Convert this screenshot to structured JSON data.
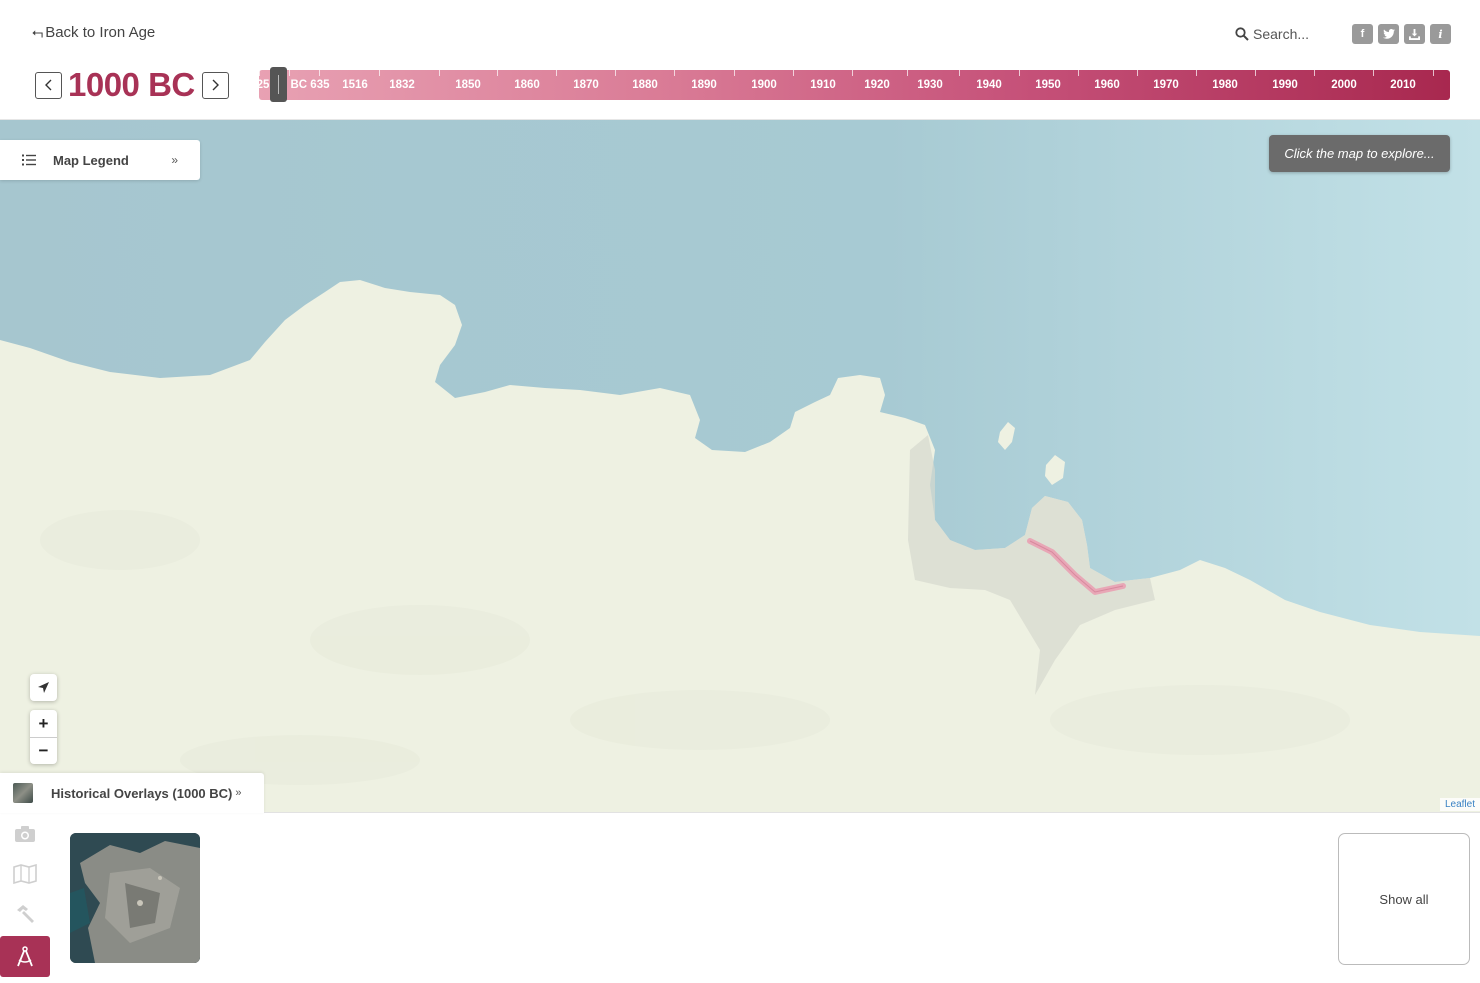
{
  "header": {
    "back_label": "Back to Iron Age",
    "search_label": "Search...",
    "social": [
      {
        "icon": "facebook-icon",
        "glyph": "f"
      },
      {
        "icon": "twitter-icon",
        "glyph": "t"
      },
      {
        "icon": "download-icon",
        "glyph": "⤓"
      },
      {
        "icon": "info-icon",
        "glyph": "i"
      }
    ]
  },
  "year_nav": {
    "current_year": "1000 BC",
    "prev_icon": "chevron-left-icon",
    "next_icon": "chevron-right-icon"
  },
  "timeline": {
    "ticks": [
      "25",
      "BC 635",
      "1516",
      "1832",
      "1850",
      "1860",
      "1870",
      "1880",
      "1890",
      "1900",
      "1910",
      "1920",
      "1930",
      "1940",
      "1950",
      "1960",
      "1970",
      "1980",
      "1990",
      "2000",
      "2010"
    ],
    "selected_index": 0
  },
  "map": {
    "legend_label": "Map Legend",
    "explore_hint": "Click the map to explore...",
    "attribution": "Leaflet",
    "zoom_in": "+",
    "zoom_out": "−",
    "colors": {
      "sea": "#a9cdd6",
      "land": "#eef1e2",
      "overlay_route": "#e8a7b6"
    }
  },
  "bottom": {
    "overlay_tab_label": "Historical Overlays (1000 BC)",
    "show_all_label": "Show all",
    "side_icons": [
      "camera-icon",
      "map-icon",
      "hammer-icon",
      "compass-icon"
    ]
  },
  "accent_color": "#a83256"
}
